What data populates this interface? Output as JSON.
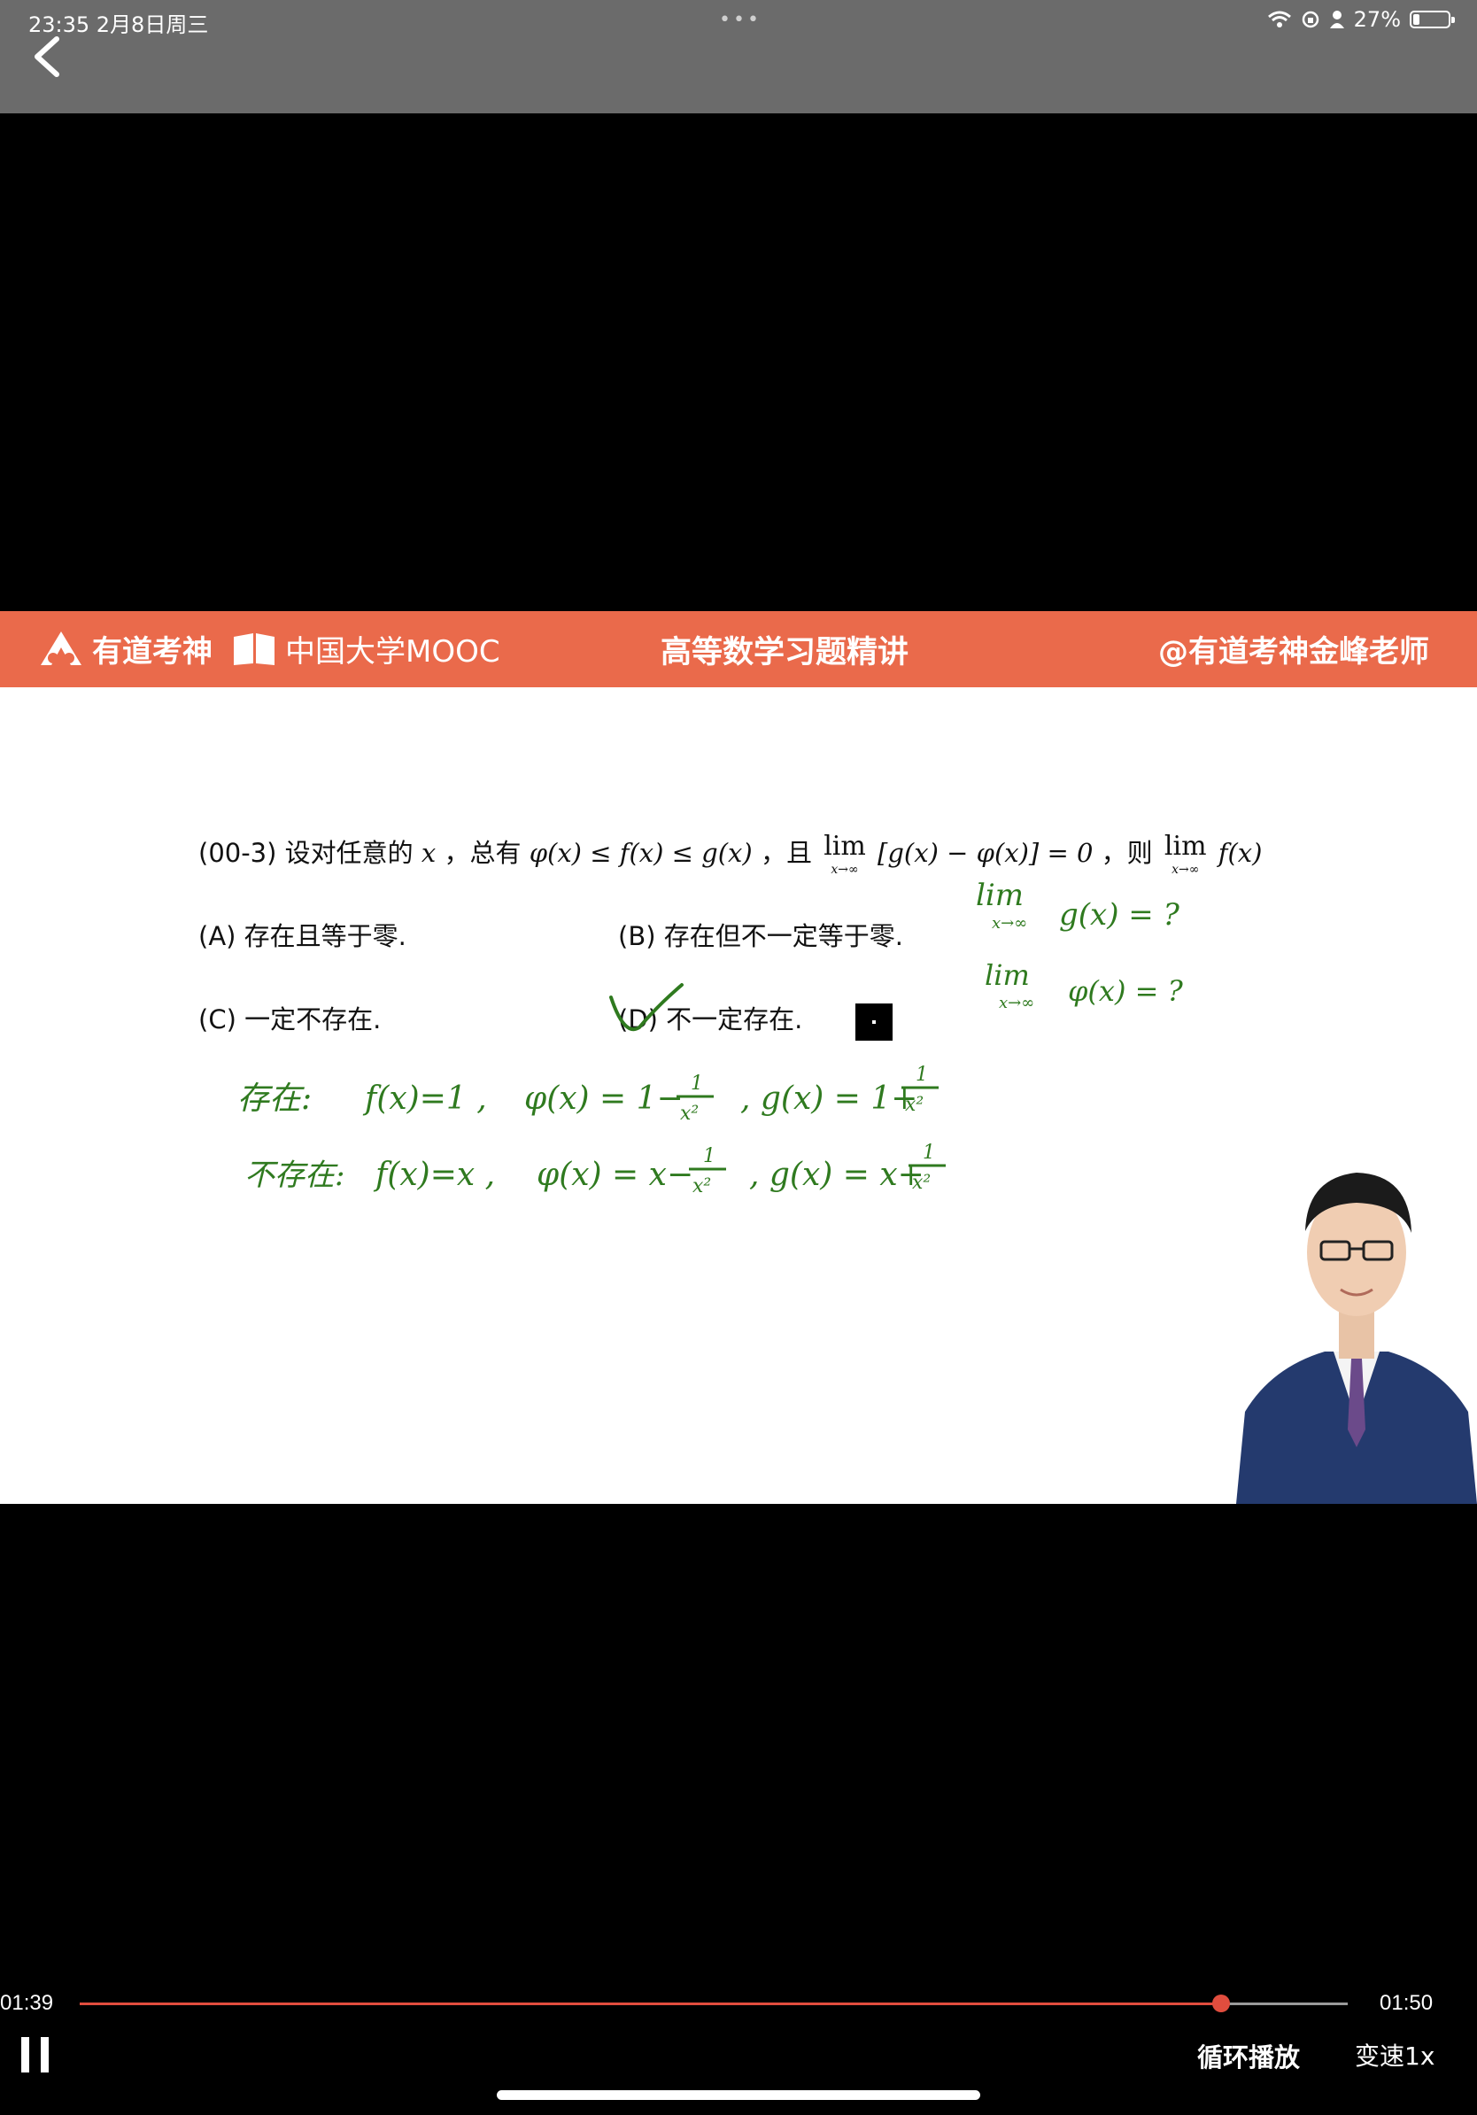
{
  "status_bar": {
    "time_date": "23:35   2月8日周三",
    "dots": "•••",
    "battery_text": "27%",
    "battery_level": 0.27
  },
  "banner": {
    "youdao": "有道考神",
    "mooc": "中国大学MOOC",
    "course": "高等数学习题精讲",
    "teacher": "@有道考神金峰老师"
  },
  "question": {
    "prefix": "(00-3) 设对任意的",
    "var_x": "x",
    "mid1": "，总有",
    "ineq": "φ(x) ≤ f(x) ≤ g(x)",
    "mid2": "，且",
    "lim_word": "lim",
    "lim_sub": "x→∞",
    "expr": "[g(x) − φ(x)] = 0",
    "mid3": "，则",
    "lim_fx": "f(x)"
  },
  "options": {
    "a": "(A) 存在且等于零.",
    "b": "(B) 存在但不一定等于零.",
    "c": "(C) 一定不存在.",
    "d": "(D) 不一定存在."
  },
  "annotations": {
    "right1_lim": "lim",
    "right1_sub": "x→∞",
    "right1": "g(x) = ?",
    "right2_lim": "lim",
    "right2_sub": "x→∞",
    "right2": "φ(x) = ?",
    "line1_label": "存在:",
    "line1_f": "f(x)=1 ,",
    "line1_phi_a": "φ(x) = 1−",
    "line1_g_a": ", g(x) = 1+",
    "line2_label": "不存在:",
    "line2_f": "f(x)=x ,",
    "line2_phi_a": "φ(x) = x−",
    "line2_g_a": ", g(x) = x+",
    "frac_num": "1",
    "frac_den": "x²",
    "ink_color": "#2f7a1f"
  },
  "player": {
    "current_time": "01:39",
    "total_time": "01:50",
    "progress": 0.9,
    "loop_label": "循环播放",
    "speed_label": "变速1x",
    "accent_color": "#e14d3e"
  }
}
